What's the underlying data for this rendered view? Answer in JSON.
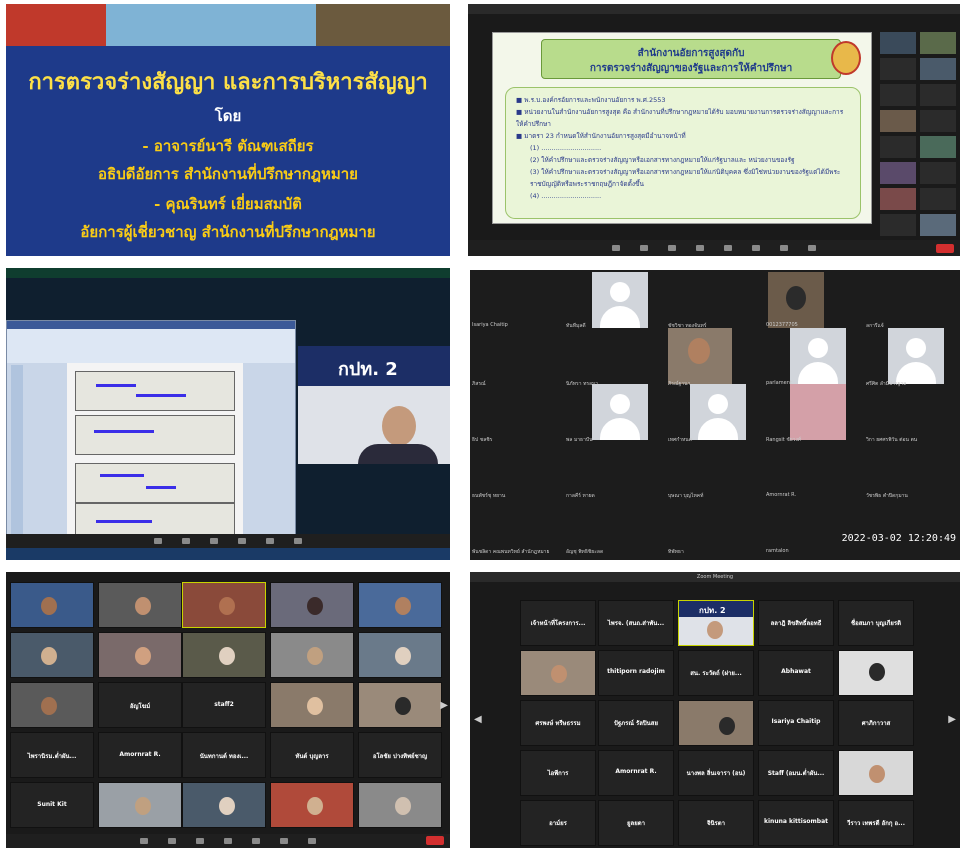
{
  "panel1": {
    "title": "การตรวจร่างสัญญา และการบริหารสัญญา",
    "by": "โดย",
    "speaker1_name": "- อาจารย์นารี ตัณฑเสถียร",
    "speaker1_role": "อธิบดีอัยการ สำนักงานที่ปรึกษากฎหมาย",
    "speaker2_name": "- คุณรินทร์ เยี่ยมสมบัติ",
    "speaker2_role": "อัยการผู้เชี่ยวชาญ สำนักงานที่ปรึกษากฎหมาย",
    "colors": {
      "background": "#1e3a8a",
      "text": "#facc15"
    }
  },
  "panel2": {
    "slide_header_line1": "สำนักงานอัยการสูงสุดกับ",
    "slide_header_line2": "การตรวจร่างสัญญาของรัฐและการให้คำปรึกษา",
    "bullets": [
      "พ.ร.บ.องค์กรอัยการและพนักงานอัยการ พ.ศ.2553",
      "หน่วยงานในสำนักงานอัยการสูงสุด คือ สำนักงานที่ปรึกษากฎหมายได้รับ มอบหมายงานการตรวจร่างสัญญาและการให้คำปรึกษา",
      "มาตรา 23 กำหนดให้สำนักงานอัยการสูงสุดมีอำนาจหน้าที่"
    ],
    "sub_items": [
      "(1) .............................",
      "(2) ให้คำปรึกษาและตรวจร่างสัญญาหรือเอกสารทางกฎหมายให้แก่รัฐบาลและ หน่วยงานของรัฐ",
      "(3) ให้คำปรึกษาและตรวจร่างสัญญาหรือเอกสารทางกฎหมายให้แก่นิติบุคคล ซึ่งมิใช่หน่วยงานของรัฐแต่ได้มีพระราชบัญญัติหรือพระราชกฤษฎีกาจัดตั้งขึ้น",
      "(4) ............................."
    ]
  },
  "panel3": {
    "logo_text": "กปท. 2"
  },
  "panel4": {
    "timestamp": "2022-03-02 12:20:49",
    "labels": [
      "Isariya Chaitip",
      "ทันทีมุลดี",
      "ชัชวิชา ทองจันทร์",
      "0012377705",
      "ลการีแจ้",
      "ภิสรณ์",
      "นิภัทรา ทรอบา",
      "ภิรณ์ฐานา",
      "parlament",
      "ศรีศิต ลำมีปารฐาล",
      "ธิป ชลชิร",
      "พล มาธาปัน",
      "เทศกำหนด",
      "Rangsit ชัยวงศ์",
      "วิกา ยศศรพิวัน ต่อน ตน",
      "ธนพัชร์ชุ หยาน",
      "กาลคีร์ หายด",
      "บุษณา บุญไหคท์",
      "Amornrat R.",
      "วัชรพิธ ตำปิดกุมาน",
      "พันชลิดา คณพนทวิทย์ สำนักฎหมาย",
      "อัญชุ พิทธิชิยะลด",
      "ทิพัทธา",
      "ramtalon"
    ]
  },
  "panel5": {
    "tiles": [
      "อัญโฆม์",
      "staff2",
      "ไพรานิรม.ต่ำผัน...",
      "Amornrat R.",
      "นันทกานต์ ทองเ...",
      "ทันต์ บุญลาร",
      "อโลชัย ปางทิพย์ชาญ",
      "Sunit Kit"
    ]
  },
  "panel6": {
    "window_title": "Zoom Meeting",
    "logo_text": "กปท. 2",
    "tiles": [
      "เจ้าหน้าที่โครงการ...",
      "ไพรจ. (สนถ.ส่าพัน...",
      "ลลาฎิ ลิขสิทธิ์ลอทธี",
      "ชื่อสมภา บุญเกียรติ",
      "thitiporn radojim",
      "สน. ระวัตถ์ (ฝาย...",
      "Abhawat",
      "ศรพงษ์ ทรีษธรรม",
      "ปัฐภรณ์ รัลปินสย",
      "Isariya Chaitip",
      "ศาภิกาวาส",
      "ไอพีการ",
      "Amornrat R.",
      "นางพล ลิ่นเจารา (อน)",
      "Staff (อมน.ต่ำผัน...",
      "อาม์ยร",
      "ยูลยดา",
      "จินิรตา",
      "kinuna kittisombat",
      "วีราว เทพรดี อักกุ อ..."
    ]
  }
}
